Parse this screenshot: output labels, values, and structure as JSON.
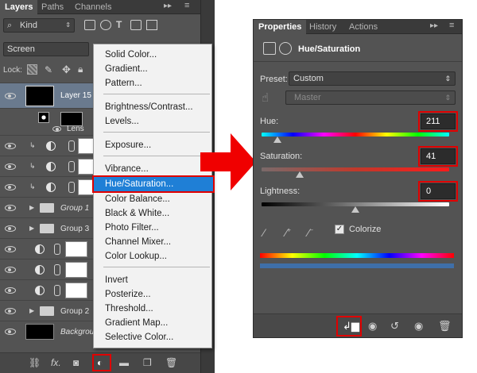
{
  "layers_panel": {
    "tabs": [
      "Layers",
      "Paths",
      "Channels"
    ],
    "filter_kind": "Kind",
    "blend_mode": "Screen",
    "lock_label": "Lock:",
    "layers": [
      {
        "name": "Layer 15",
        "type": "layer"
      },
      {
        "name": "Lens",
        "type": "effect"
      },
      {
        "name": "Group 1",
        "type": "group"
      },
      {
        "name": "Group 3",
        "type": "group"
      },
      {
        "name": "Group 2",
        "type": "group"
      },
      {
        "name": "Background",
        "type": "layer"
      }
    ]
  },
  "adjustment_menu": {
    "groups": [
      [
        "Solid Color...",
        "Gradient...",
        "Pattern..."
      ],
      [
        "Brightness/Contrast...",
        "Levels..."
      ],
      [
        "Exposure..."
      ],
      [
        "Vibrance...",
        "Hue/Saturation...",
        "Color Balance...",
        "Black & White...",
        "Photo Filter...",
        "Channel Mixer...",
        "Color Lookup..."
      ],
      [
        "Invert",
        "Posterize...",
        "Threshold...",
        "Gradient Map...",
        "Selective Color..."
      ]
    ],
    "selected": "Hue/Saturation..."
  },
  "properties_panel": {
    "tabs": [
      "Properties",
      "History",
      "Actions"
    ],
    "title": "Hue/Saturation",
    "preset_label": "Preset:",
    "preset_value": "Custom",
    "channel_value": "Master",
    "hue_label": "Hue:",
    "hue_value": "211",
    "saturation_label": "Saturation:",
    "saturation_value": "41",
    "lightness_label": "Lightness:",
    "lightness_value": "0",
    "colorize_label": "Colorize",
    "colorize_checked": true,
    "slider_levels": {
      "hue": 211,
      "hue_range": [
        -180,
        180
      ],
      "saturation": 41,
      "saturation_range": [
        -100,
        100
      ],
      "lightness": 0,
      "lightness_range": [
        -100,
        100
      ]
    }
  },
  "colors": {
    "panel_bg": "#535353",
    "highlight_red": "#e00000",
    "menu_selected": "#1f7fd6"
  }
}
